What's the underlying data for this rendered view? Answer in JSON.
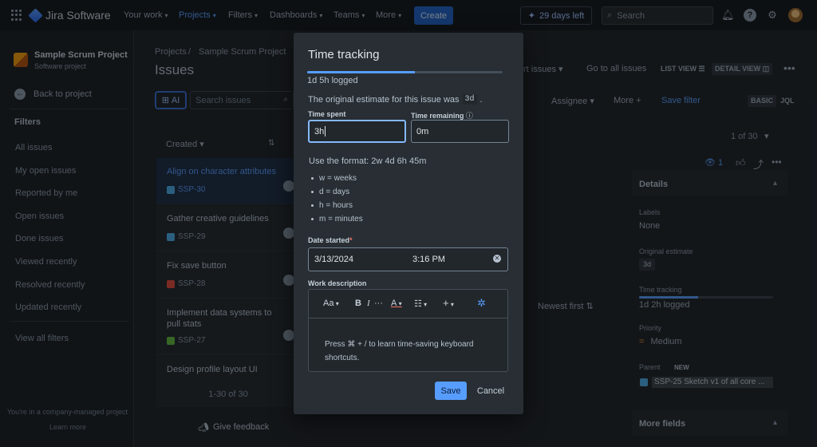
{
  "topnav": {
    "app_name": "Jira Software",
    "items": [
      "Your work",
      "Projects",
      "Filters",
      "Dashboards",
      "Teams",
      "More"
    ],
    "create_label": "Create",
    "trial_label": "29 days left",
    "search_placeholder": "Search"
  },
  "sidebar": {
    "project_name": "Sample Scrum Project",
    "project_type": "Software project",
    "back_label": "Back to project",
    "filters_heading": "Filters",
    "filters": [
      "All issues",
      "My open issues",
      "Reported by me",
      "Open issues",
      "Done issues",
      "Viewed recently",
      "Resolved recently",
      "Updated recently"
    ],
    "view_all": "View all filters",
    "footer_text": "You're in a company-managed project",
    "learn_more": "Learn more"
  },
  "main": {
    "breadcrumbs": [
      "Projects",
      "Sample Scrum Project"
    ],
    "title": "Issues",
    "ai_label": "AI",
    "search_placeholder": "Search issues",
    "sort_label": "Created",
    "issues": [
      {
        "title": "Align on character attributes",
        "key": "SSP-30",
        "type": "task"
      },
      {
        "title": "Gather creative guidelines",
        "key": "SSP-29",
        "type": "task"
      },
      {
        "title": "Fix save button",
        "key": "SSP-28",
        "type": "bug"
      },
      {
        "title": "Implement data systems to pull stats",
        "key": "SSP-27",
        "type": "task"
      },
      {
        "title": "Design profile layout UI",
        "key": "",
        "type": "task"
      }
    ],
    "pager": "1-30 of 30",
    "feedback": "Give feedback",
    "toolbar": {
      "export": "rt issues",
      "go_all": "Go to all issues",
      "list_view": "LIST VIEW",
      "detail_view": "DETAIL VIEW",
      "assignee": "Assignee",
      "more": "More",
      "save_filter": "Save filter",
      "basic": "BASIC",
      "jql": "JQL",
      "newest_first": "Newest first"
    }
  },
  "details": {
    "counter": "1 of 30",
    "watchers": "1",
    "heading": "Details",
    "labels_label": "Labels",
    "labels_value": "None",
    "orig_label": "Original estimate",
    "orig_value": "3d",
    "tt_label": "Time tracking",
    "tt_value": "1d 2h logged",
    "tt_fraction": 0.44,
    "priority_label": "Priority",
    "priority_value": "Medium",
    "parent_label": "Parent",
    "parent_badge": "NEW",
    "parent_value": "SSP-25 Sketch v1 of all core ...",
    "more_fields": "More fields"
  },
  "modal": {
    "title": "Time tracking",
    "logged_text": "1d 5h logged",
    "logged_fraction": 0.55,
    "orig_text": "The original estimate for this issue was",
    "orig_value": "3d",
    "orig_suffix": ".",
    "time_spent_label": "Time spent",
    "time_spent_value": "3h",
    "time_remaining_label": "Time remaining",
    "time_remaining_value": "0m",
    "format_text": "Use the format: 2w 4d 6h 45m",
    "format_items": [
      "w = weeks",
      "d = days",
      "h = hours",
      "m = minutes"
    ],
    "date_label": "Date started",
    "date_value": "3/13/2024",
    "time_value": "3:16 PM",
    "work_desc_label": "Work description",
    "editor_text_style": "Aa",
    "editor_bold": "B",
    "editor_italic": "I",
    "editor_color": "A",
    "editor_hint": "Press ⌘ + / to learn time-saving keyboard shortcuts.",
    "save_label": "Save",
    "cancel_label": "Cancel"
  },
  "colors": {
    "accent": "#579dff",
    "background": "#1d2125",
    "modal": "#282e33"
  }
}
